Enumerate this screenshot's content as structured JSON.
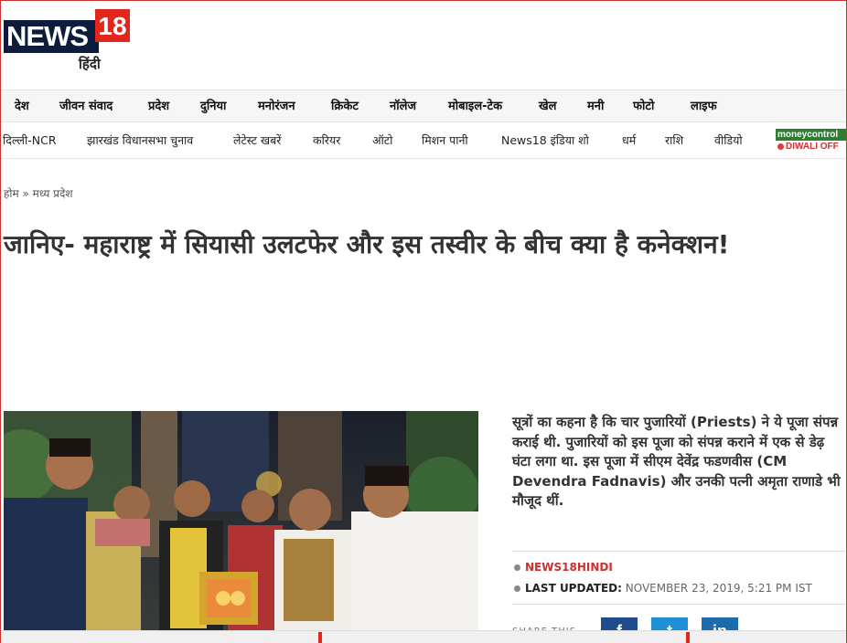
{
  "brand": {
    "logo_text": "NEWS",
    "logo_number": "18",
    "logo_sub": "हिंदी"
  },
  "nav_primary": [
    "देश",
    "जीवन संवाद",
    "प्रदेश",
    "दुनिया",
    "मनोरंजन",
    "क्रिकेट",
    "नॉलेज",
    "मोबाइल-टेक",
    "खेल",
    "मनी",
    "फोटो",
    "लाइफ"
  ],
  "nav_secondary": [
    "दिल्ली-NCR",
    "झारखंड विधानसभा चुनाव",
    "लेटेस्ट खबरें",
    "करियर",
    "ऑटो",
    "मिशन पानी",
    "News18 इंडिया शो",
    "धर्म",
    "राशि",
    "वीडियो"
  ],
  "promo": {
    "brand": "moneycontrol",
    "text": "DIWALI OFF"
  },
  "breadcrumb": {
    "home": "होम",
    "sep": "»",
    "current": "मध्य प्रदेश"
  },
  "headline": "जानिए- महाराष्ट्र में सियासी उलटफेर और इस तस्वीर के बीच क्या है कनेक्शन!",
  "article_text": "सूत्रों का कहना है कि चार पुजारियों (Priests) ने ये पूजा संपन्न कराई थी. पुजारियों को इस पूजा को संपन्न कराने में एक से डेढ़ घंटा लगा था. इस पूजा में सीएम देवेंद्र फडणवीस (CM Devendra Fadnavis) और उनकी पत्नी अमृता राणाडे भी मौजूद थीं.",
  "meta": {
    "author": "NEWS18HINDI",
    "updated_label": "LAST UPDATED:",
    "updated_value": "NOVEMBER 23, 2019, 5:21 PM IST"
  },
  "share": {
    "label": "SHARE THIS",
    "facebook": "f",
    "twitter": "t",
    "linkedin": "in"
  },
  "colors": {
    "brand_red": "#e1261c",
    "brand_navy": "#0d1b3c",
    "facebook": "#1f4c8f",
    "twitter": "#1f8fd8",
    "linkedin": "#1c6bad"
  }
}
